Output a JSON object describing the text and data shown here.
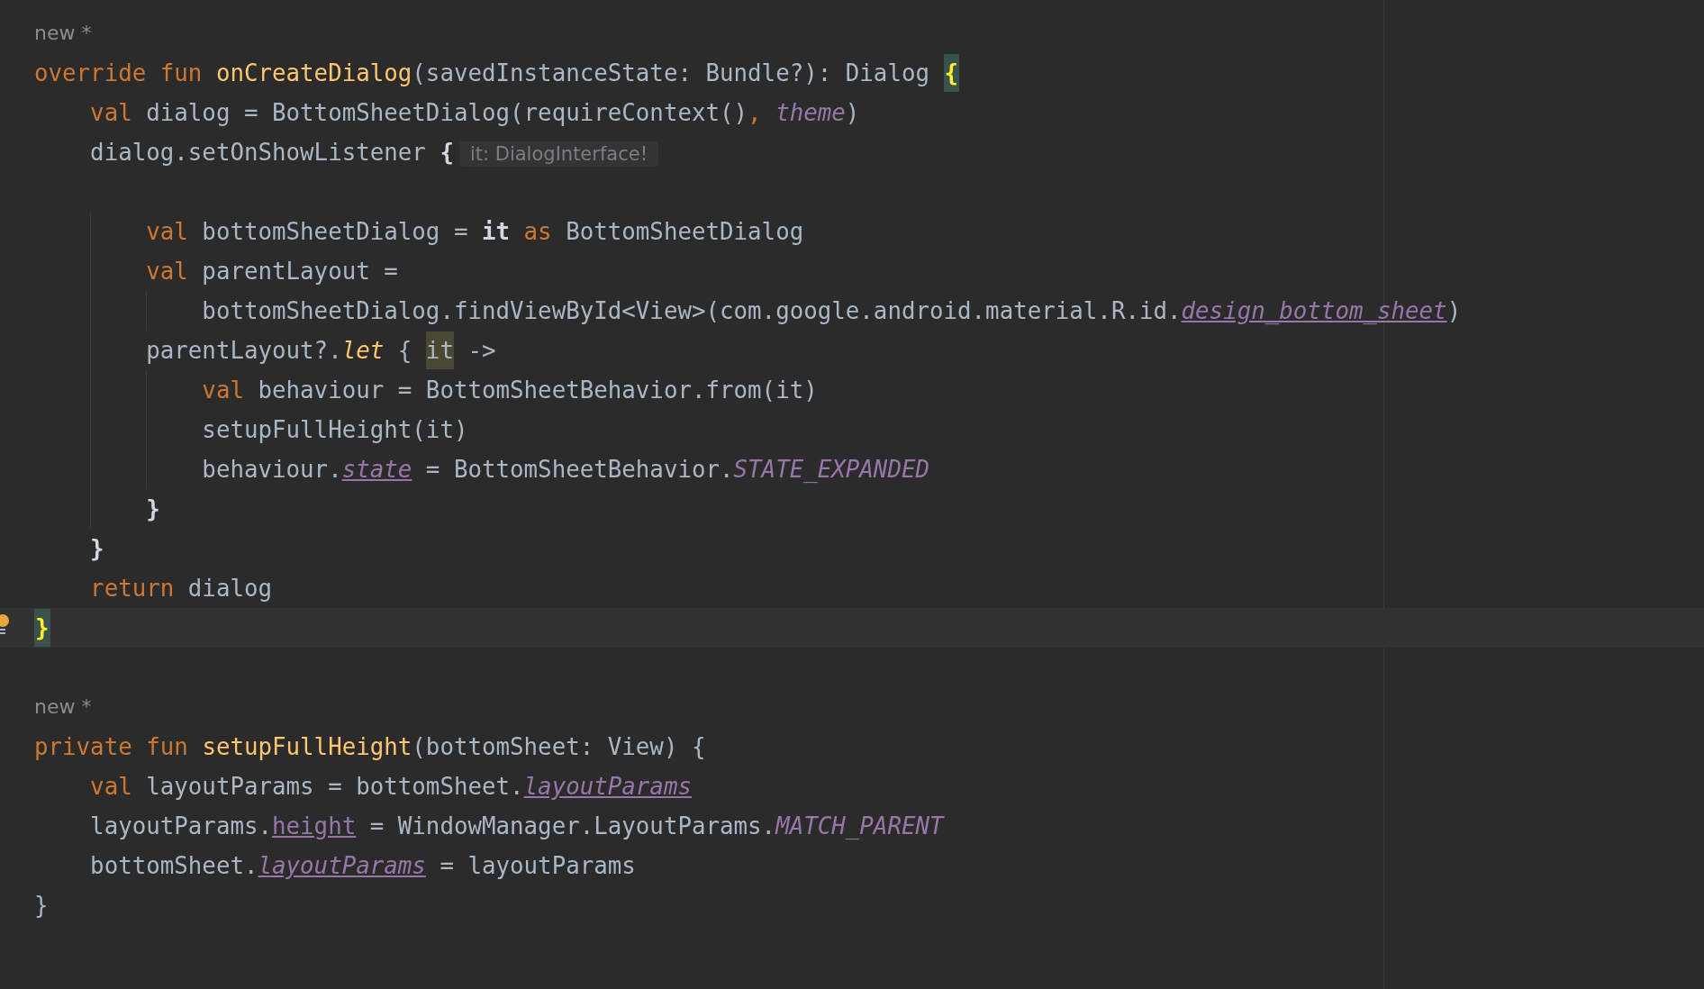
{
  "editor": {
    "blocks": [
      {
        "annotation": "new *",
        "lines": [
          {
            "current": false,
            "tokens": [
              {
                "t": "override fun ",
                "kind": "kw"
              },
              {
                "t": "onCreateDialog",
                "kind": "fn"
              },
              {
                "t": "(savedInstanceState: Bundle?): Dialog ",
                "kind": "plain"
              },
              {
                "t": "{",
                "kind": "brace"
              }
            ]
          },
          {
            "current": false,
            "tokens": [
              {
                "t": "    val ",
                "kind": "kw"
              },
              {
                "t": "dialog = BottomSheetDialog(requireContext()",
                "kind": "plain"
              },
              {
                "t": ", ",
                "kind": "kw"
              },
              {
                "t": "theme",
                "kind": "static"
              },
              {
                "t": ")",
                "kind": "plain"
              }
            ]
          },
          {
            "current": false,
            "tokens": [
              {
                "t": "    dialog.setOnShowListener ",
                "kind": "plain"
              },
              {
                "t": "{",
                "kind": "bold"
              },
              {
                "t": "it: DialogInterface!",
                "kind": "hint"
              }
            ]
          },
          {
            "current": false
          },
          {
            "current": false,
            "tokens": [
              {
                "t": "        val ",
                "kind": "kw"
              },
              {
                "t": "bottomSheetDialog = ",
                "kind": "plain"
              },
              {
                "t": "it",
                "kind": "bold"
              },
              {
                "t": " as ",
                "kind": "kw"
              },
              {
                "t": "BottomSheetDialog",
                "kind": "plain"
              }
            ]
          },
          {
            "current": false,
            "tokens": [
              {
                "t": "        val ",
                "kind": "kw"
              },
              {
                "t": "parentLayout =",
                "kind": "plain"
              }
            ]
          },
          {
            "current": false,
            "tokens": [
              {
                "t": "            bottomSheetDialog.findViewById<View>(com.google.android.material.R.id.",
                "kind": "plain"
              },
              {
                "t": "design_bottom_sheet",
                "kind": "ext"
              },
              {
                "t": ")",
                "kind": "plain"
              }
            ]
          },
          {
            "current": false,
            "tokens": [
              {
                "t": "        parentLayout?.",
                "kind": "plain"
              },
              {
                "t": "let",
                "kind": "extfn"
              },
              {
                "t": " { ",
                "kind": "plain"
              },
              {
                "t": "it",
                "kind": "usage"
              },
              {
                "t": " ->",
                "kind": "plain"
              }
            ]
          },
          {
            "current": false,
            "tokens": [
              {
                "t": "            val ",
                "kind": "kw"
              },
              {
                "t": "behaviour = BottomSheetBehavior.from(it)",
                "kind": "plain"
              }
            ]
          },
          {
            "current": false,
            "tokens": [
              {
                "t": "            setupFullHeight(it)",
                "kind": "plain"
              }
            ]
          },
          {
            "current": false,
            "tokens": [
              {
                "t": "            behaviour.",
                "kind": "plain"
              },
              {
                "t": "state",
                "kind": "ext"
              },
              {
                "t": " = BottomSheetBehavior.",
                "kind": "plain"
              },
              {
                "t": "STATE_EXPANDED",
                "kind": "static"
              }
            ]
          },
          {
            "current": false,
            "tokens": [
              {
                "t": "        }",
                "kind": "bold"
              }
            ]
          },
          {
            "current": false,
            "tokens": [
              {
                "t": "    }",
                "kind": "bold"
              }
            ]
          },
          {
            "current": false,
            "tokens": [
              {
                "t": "    return ",
                "kind": "kw"
              },
              {
                "t": "dialog",
                "kind": "plain"
              }
            ]
          },
          {
            "current": true,
            "tokens": [
              {
                "t": "}",
                "kind": "brace"
              }
            ]
          },
          {
            "current": false
          }
        ]
      },
      {
        "annotation": "new *",
        "lines": [
          {
            "current": false,
            "tokens": [
              {
                "t": "private fun ",
                "kind": "kw"
              },
              {
                "t": "setupFullHeight",
                "kind": "fn"
              },
              {
                "t": "(bottomSheet: View) {",
                "kind": "plain"
              }
            ]
          },
          {
            "current": false,
            "tokens": [
              {
                "t": "    val ",
                "kind": "kw"
              },
              {
                "t": "layoutParams = bottomSheet.",
                "kind": "plain"
              },
              {
                "t": "layoutParams",
                "kind": "ext"
              }
            ]
          },
          {
            "current": false,
            "tokens": [
              {
                "t": "    layoutParams.",
                "kind": "plain"
              },
              {
                "t": "height",
                "kind": "field"
              },
              {
                "t": " = WindowManager.LayoutParams.",
                "kind": "plain"
              },
              {
                "t": "MATCH_PARENT",
                "kind": "static"
              }
            ]
          },
          {
            "current": false,
            "tokens": [
              {
                "t": "    bottomSheet.",
                "kind": "plain"
              },
              {
                "t": "layoutParams",
                "kind": "ext"
              },
              {
                "t": " = layoutParams",
                "kind": "plain"
              }
            ]
          },
          {
            "current": false,
            "tokens": [
              {
                "t": "}",
                "kind": "plain"
              }
            ]
          }
        ]
      }
    ]
  }
}
